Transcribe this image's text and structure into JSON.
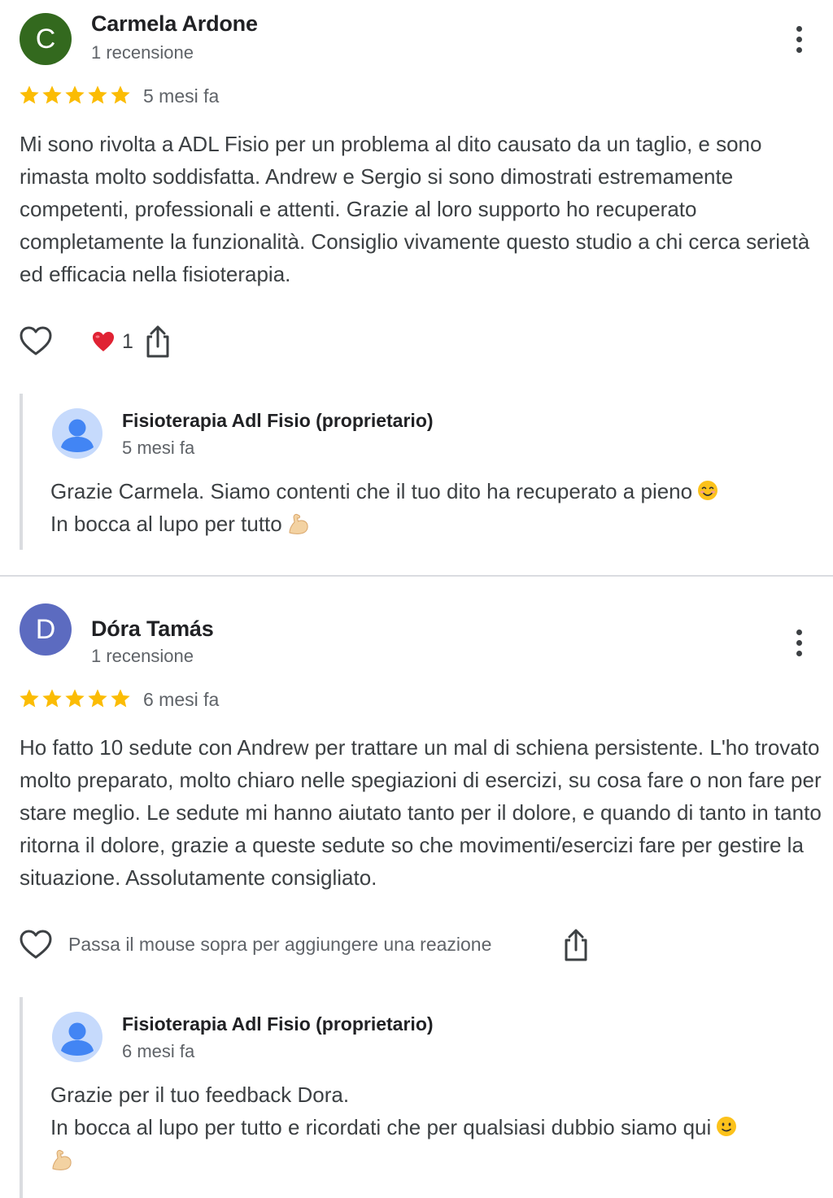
{
  "reviews": [
    {
      "avatar_letter": "C",
      "avatar_color": "#33691e",
      "author": "Carmela Ardone",
      "author_meta": "1 recensione",
      "rating": 5,
      "date": "5 mesi fa",
      "text": "Mi sono rivolta a ADL Fisio per un problema al dito causato da un taglio, e sono rimasta molto soddisfatta. Andrew e Sergio si sono dimostrati estremamente competenti, professionali e attenti. Grazie al loro supporto ho recuperato completamente la funzionalità. Consiglio vivamente questo studio a chi cerca serietà ed efficacia nella fisioterapia.",
      "reaction_icon": "red-heart-emoji",
      "reaction_count": "1",
      "owner_reply": {
        "name": "Fisioterapia Adl Fisio (proprietario)",
        "date": "5 mesi fa",
        "line1": "Grazie Carmela. Siamo contenti che il tuo dito ha recuperato a pieno",
        "line2": "In bocca al lupo per tutto"
      }
    },
    {
      "avatar_letter": "D",
      "avatar_color": "#5c6bc0",
      "author": "Dóra Tamás",
      "author_meta": "1 recensione",
      "rating": 5,
      "date": "6 mesi fa",
      "text": "Ho fatto 10 sedute con Andrew per trattare un mal di schiena persistente. L'ho trovato molto preparato, molto chiaro nelle spegiazioni di esercizi, su cosa fare o non fare per stare meglio. Le sedute mi hanno aiutato tanto per il dolore, e quando di tanto in tanto ritorna il dolore, grazie a queste sedute so che movimenti/esercizi fare per gestire la situazione. Assolutamente consigliato.",
      "hover_hint": "Passa il mouse sopra per aggiungere una reazione",
      "owner_reply": {
        "name": "Fisioterapia Adl Fisio (proprietario)",
        "date": "6 mesi fa",
        "line1": "Grazie per il tuo feedback Dora.",
        "line2": "In bocca al lupo per tutto e ricordati che per qualsiasi dubbio siamo qui"
      }
    }
  ],
  "colors": {
    "star": "#fbbc04",
    "owner_avatar_bg": "#c6dafc",
    "owner_avatar_fg": "#4285f4"
  }
}
